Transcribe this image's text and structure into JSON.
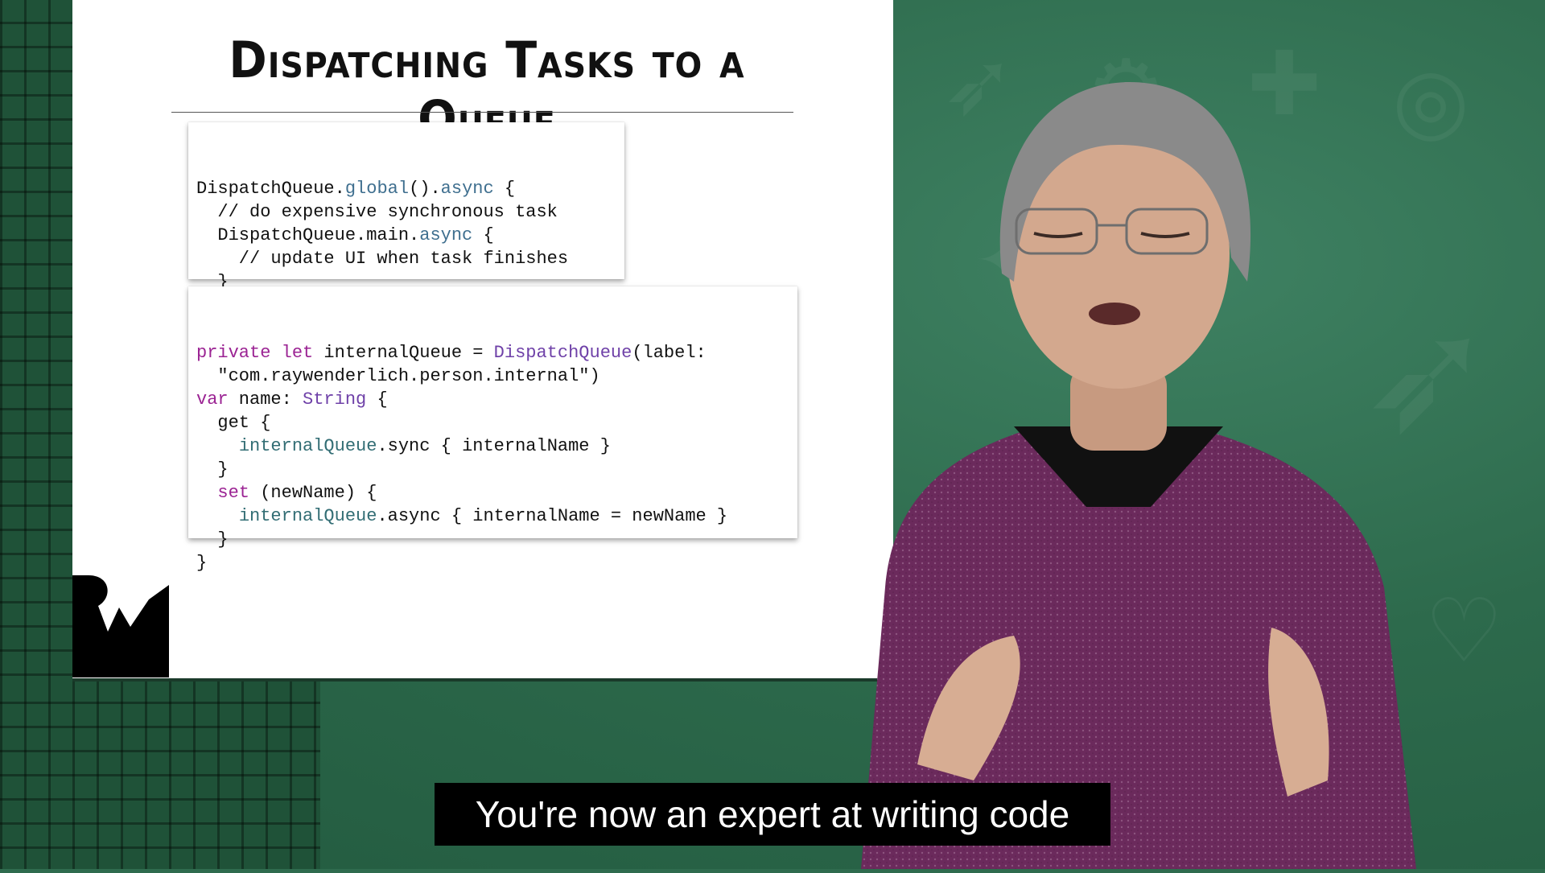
{
  "slide": {
    "title": "Dispatching Tasks to a Queue"
  },
  "code_block_1": [
    [
      {
        "text": "DispatchQueue."
      },
      {
        "text": "global",
        "cls": "m"
      },
      {
        "text": "()."
      },
      {
        "text": "async",
        "cls": "m"
      },
      {
        "text": " {"
      }
    ],
    [
      {
        "text": "  // do expensive synchronous task"
      }
    ],
    [
      {
        "text": "  DispatchQueue.main."
      },
      {
        "text": "async",
        "cls": "m"
      },
      {
        "text": " {"
      }
    ],
    [
      {
        "text": "    // update UI when task finishes"
      }
    ],
    [
      {
        "text": "  }"
      }
    ],
    [
      {
        "text": "}"
      }
    ]
  ],
  "code_block_2": [
    [
      {
        "text": "private",
        "cls": "k"
      },
      {
        "text": " "
      },
      {
        "text": "let",
        "cls": "k"
      },
      {
        "text": " internalQueue = "
      },
      {
        "text": "DispatchQueue",
        "cls": "t"
      },
      {
        "text": "(label:"
      }
    ],
    [
      {
        "text": "  \"com.raywenderlich.person.internal\")"
      }
    ],
    [
      {
        "text": "var",
        "cls": "k"
      },
      {
        "text": " name: "
      },
      {
        "text": "String",
        "cls": "t"
      },
      {
        "text": " {"
      }
    ],
    [
      {
        "text": "  get {"
      }
    ],
    [
      {
        "text": "    "
      },
      {
        "text": "internalQueue",
        "cls": "f"
      },
      {
        "text": ".sync { internalName }"
      }
    ],
    [
      {
        "text": "  }"
      }
    ],
    [
      {
        "text": "  "
      },
      {
        "text": "set",
        "cls": "k"
      },
      {
        "text": " (newName) {"
      }
    ],
    [
      {
        "text": "    "
      },
      {
        "text": "internalQueue",
        "cls": "f"
      },
      {
        "text": ".async { internalName = newName }"
      }
    ],
    [
      {
        "text": "  }"
      }
    ],
    [
      {
        "text": "}"
      }
    ]
  ],
  "caption": {
    "text": "You're now an expert at writing code"
  },
  "colors": {
    "keyword": "#9b2393",
    "type": "#6f41a8",
    "method": "#3f6f8f",
    "field": "#326d74",
    "background_green": "#2f6b4e"
  },
  "logo": {
    "name": "rw-logo"
  }
}
